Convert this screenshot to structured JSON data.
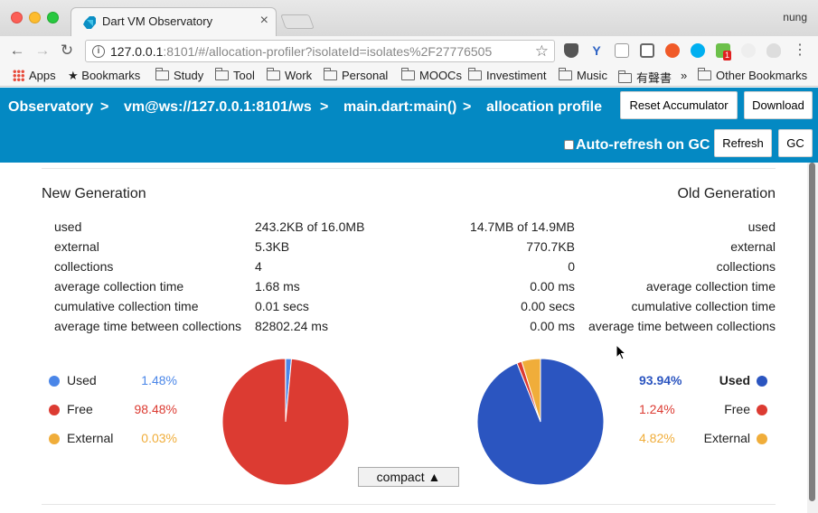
{
  "browser": {
    "tab_title": "Dart VM Observatory",
    "profile_name": "nung",
    "url_host": "127.0.0.1",
    "url_rest": ":8101/#/allocation-profiler?isolateId=isolates%2F27776505",
    "extension_badge": "1",
    "bookmarks": {
      "apps": "Apps",
      "bookmarks": "Bookmarks",
      "folders": [
        "Study",
        "Tool",
        "Work",
        "Personal",
        "MOOCs",
        "Investiment",
        "Music",
        "有聲書"
      ],
      "overflow": "»",
      "other": "Other Bookmarks"
    }
  },
  "nav": {
    "crumbs": [
      "Observatory",
      ">",
      "vm@ws://127.0.0.1:8101/ws",
      ">",
      "main.dart:main()",
      ">",
      "allocation profile"
    ],
    "reset_label": "Reset Accumulator",
    "download_label": "Download",
    "autorefresh_label": "Auto-refresh on GC",
    "refresh_label": "Refresh",
    "gc_label": "GC"
  },
  "new_gen": {
    "title": "New Generation",
    "rows": [
      {
        "label": "used",
        "value": "243.2KB of 16.0MB"
      },
      {
        "label": "external",
        "value": "5.3KB"
      },
      {
        "label": "collections",
        "value": "4"
      },
      {
        "label": "average collection time",
        "value": "1.68 ms"
      },
      {
        "label": "cumulative collection time",
        "value": "0.01 secs"
      },
      {
        "label": "average time between collections",
        "value": "82802.24 ms"
      }
    ],
    "legend": [
      {
        "label": "Used",
        "pct": "1.48%",
        "color": "#4a86e8"
      },
      {
        "label": "Free",
        "pct": "98.48%",
        "color": "#dc3b32"
      },
      {
        "label": "External",
        "pct": "0.03%",
        "color": "#f0ad3a"
      }
    ],
    "pie": [
      1.48,
      98.48,
      0.03
    ]
  },
  "old_gen": {
    "title": "Old Generation",
    "rows": [
      {
        "label": "used",
        "value": "14.7MB of 14.9MB"
      },
      {
        "label": "external",
        "value": "770.7KB"
      },
      {
        "label": "collections",
        "value": "0"
      },
      {
        "label": "average collection time",
        "value": "0.00 ms"
      },
      {
        "label": "cumulative collection time",
        "value": "0.00 secs"
      },
      {
        "label": "average time between collections",
        "value": "0.00 ms"
      }
    ],
    "legend": [
      {
        "label": "Used",
        "pct": "93.94%",
        "color": "#2b55c0"
      },
      {
        "label": "Free",
        "pct": "1.24%",
        "color": "#dc3b32"
      },
      {
        "label": "External",
        "pct": "4.82%",
        "color": "#f0ad3a"
      }
    ],
    "pie": [
      93.94,
      1.24,
      4.82
    ]
  },
  "compact_label": "compact ▲",
  "colors": {
    "nav_bg": "#0489c3",
    "used_new": "#4a86e8",
    "used_old": "#2b55c0",
    "free": "#dc3b32",
    "external": "#f0ad3a"
  }
}
